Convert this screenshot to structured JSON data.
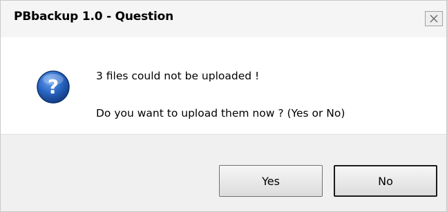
{
  "window": {
    "title": "PBbackup 1.0 - Question",
    "close_icon": "close-icon"
  },
  "message": {
    "icon": "question-icon",
    "line1": "3 files could not be uploaded !",
    "line2": "Do you want to upload them now ? (Yes or No)"
  },
  "buttons": {
    "yes_label": "Yes",
    "no_label": "No"
  },
  "colors": {
    "icon_blue": "#1f5fb8",
    "dialog_background": "#ffffff",
    "footer_background": "#f0f0f0"
  }
}
